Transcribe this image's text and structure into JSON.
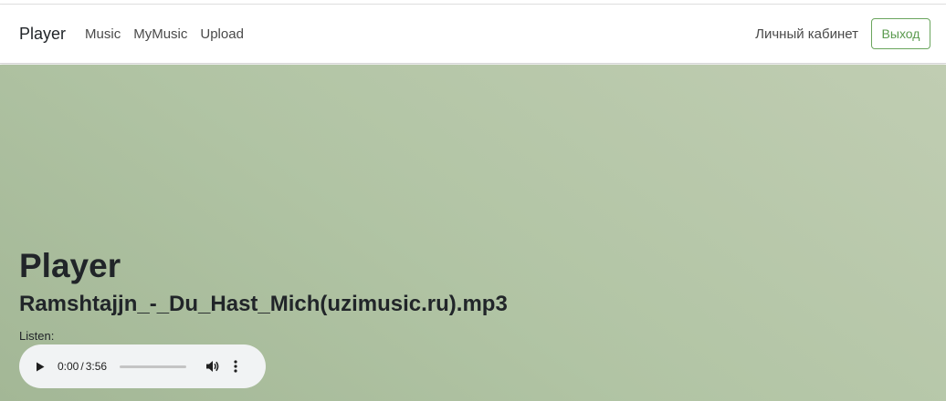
{
  "navbar": {
    "brand": "Player",
    "links": [
      "Music",
      "MyMusic",
      "Upload"
    ],
    "account_label": "Личный кабинет",
    "logout_label": "Выход"
  },
  "main": {
    "title": "Player",
    "track_name": "Ramshtajjn_-_Du_Hast_Mich(uzimusic.ru).mp3",
    "listen_label": "Listen:"
  },
  "audio": {
    "current_time": "0:00",
    "separator": "/",
    "duration": "3:56",
    "progress": 0,
    "icons": [
      "play-icon",
      "volume-icon",
      "more-vert-icon"
    ]
  },
  "colors": {
    "accent": "#5a9a4e",
    "hero_start": "#a3b796",
    "hero_end": "#c0cdb2"
  }
}
